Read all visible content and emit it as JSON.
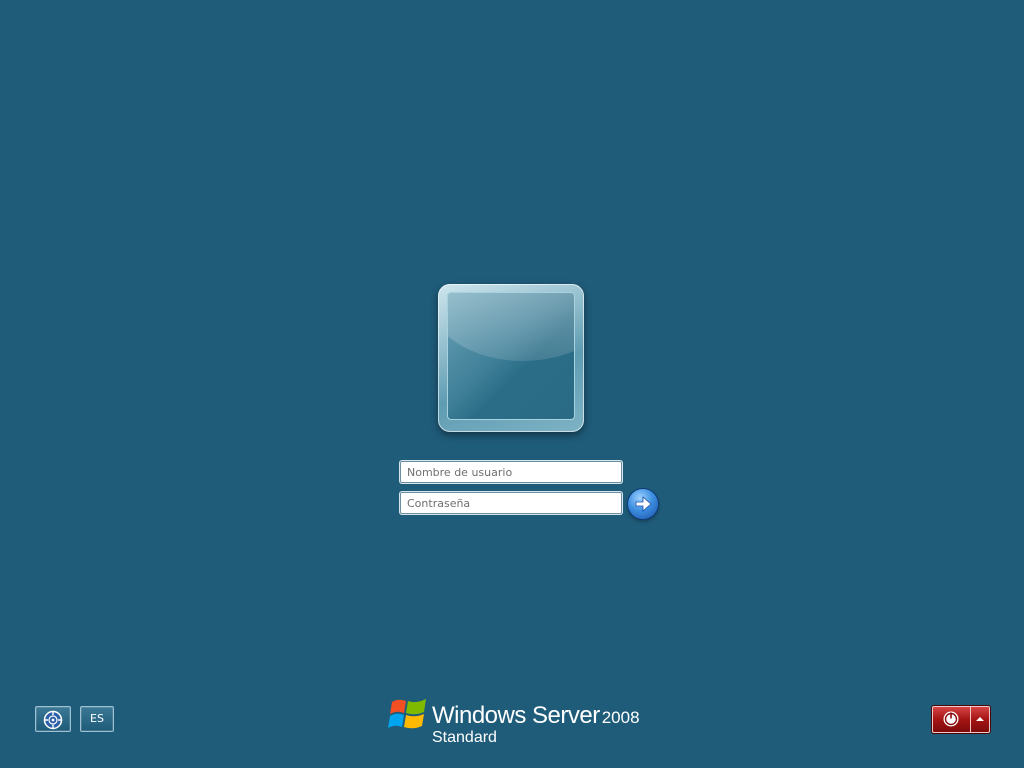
{
  "login": {
    "username_placeholder": "Nombre de usuario",
    "password_placeholder": "Contraseña",
    "username_value": "",
    "password_value": ""
  },
  "bottom_left": {
    "ease_of_access_icon": "ease-of-access-icon",
    "language_label": "ES"
  },
  "logo": {
    "brand": "Windows Server",
    "year": "2008",
    "edition": "Standard"
  },
  "shutdown": {
    "power_icon": "power-icon",
    "options_icon": "chevron-up-icon"
  },
  "colors": {
    "background": "#1f5c7a",
    "shutdown_red": "#a51414",
    "accent_blue": "#3d8fe0"
  }
}
